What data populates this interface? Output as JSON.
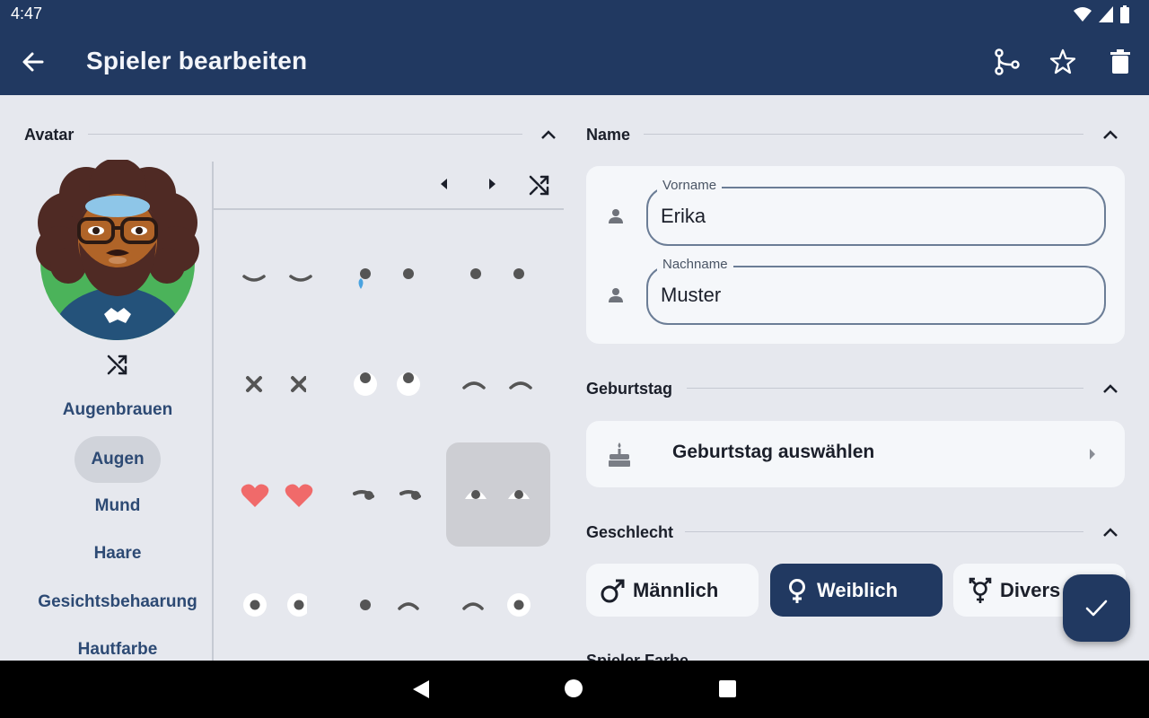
{
  "status_bar": {
    "time": "4:47",
    "icons": [
      "wifi-icon",
      "signal-icon",
      "battery-icon"
    ]
  },
  "app_bar": {
    "title": "Spieler bearbeiten",
    "back_icon": "arrow-left-icon",
    "actions": [
      "merge-icon",
      "star-outline-icon",
      "trash-icon"
    ]
  },
  "avatar_section": {
    "title": "Avatar",
    "categories": [
      "Augenbrauen",
      "Augen",
      "Mund",
      "Haare",
      "Gesichtsbehaarung",
      "Hautfarbe"
    ],
    "active_category": "Augen",
    "eye_options": [
      "squint",
      "tear",
      "default-dots",
      "cross",
      "surprised",
      "raised",
      "hearts",
      "wink-side",
      "happy-selected",
      "round-eyes",
      "wink-left",
      "wink-right"
    ],
    "selected_option": "happy-selected"
  },
  "name_section": {
    "title": "Name",
    "first_name": {
      "label": "Vorname",
      "value": "Erika"
    },
    "last_name": {
      "label": "Nachname",
      "value": "Muster"
    }
  },
  "birthday_section": {
    "title": "Geburtstag",
    "button_label": "Geburtstag auswählen"
  },
  "gender_section": {
    "title": "Geschlecht",
    "options": [
      "Männlich",
      "Weiblich",
      "Divers"
    ],
    "selected": "Weiblich"
  },
  "color_section": {
    "title": "Spieler Farbe"
  },
  "colors": {
    "primary": "#213961",
    "background": "#e6e8ee",
    "card": "#f5f7fa",
    "heart": "#f06a6a"
  }
}
